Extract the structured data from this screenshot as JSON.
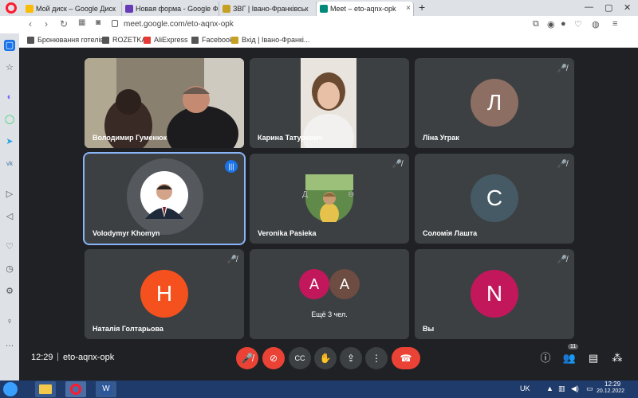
{
  "browser": {
    "tabs": [
      {
        "label": "Мой диск – Google Диск",
        "active": false
      },
      {
        "label": "Новая форма - Google Ф",
        "active": false
      },
      {
        "label": "ЗВГ | Івано-Франківськ",
        "active": false
      },
      {
        "label": "Meet – eto-aqnx-opk",
        "active": true
      }
    ],
    "url": "meet.google.com/eto-aqnx-opk",
    "bookmarks": [
      "Бронювання готелів",
      "ROZETKA",
      "AliExpress",
      "Facebook",
      "Вхід | Івано-Франкі..."
    ]
  },
  "tiles": [
    {
      "name": "Володимир Гуменюк",
      "type": "video"
    },
    {
      "name": "Карина Татуревич",
      "type": "video"
    },
    {
      "name": "Ліна Уграк",
      "type": "avatar",
      "initial": "Л",
      "color": "#8d6e63"
    },
    {
      "name": "Volodymyr Khomyn",
      "type": "photo"
    },
    {
      "name": "Veronika Pasieka",
      "type": "photo"
    },
    {
      "name": "Соломія Лашта",
      "type": "avatar",
      "initial": "С",
      "color": "#455a64"
    },
    {
      "name": "Наталія Голтарьова",
      "type": "avatar",
      "initial": "Н",
      "color": "#f4511e"
    },
    {
      "name": "Ещё 3 чел.",
      "type": "group",
      "initials": [
        "А",
        "А"
      ],
      "colors": [
        "#c2185b",
        "#6d4c41"
      ]
    },
    {
      "name": "Вы",
      "type": "avatar",
      "initial": "N",
      "color": "#c2185b"
    }
  ],
  "controls": {
    "time": "12:29",
    "meeting_code": "eto-aqnx-opk",
    "participants_count": "11"
  },
  "taskbar": {
    "lang": "UK",
    "time": "12:29",
    "date": "20.12.2022"
  }
}
